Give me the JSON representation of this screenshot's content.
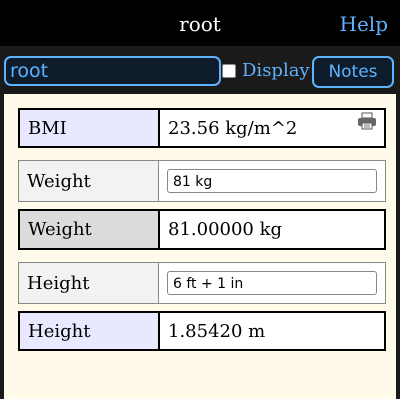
{
  "header": {
    "title": "root",
    "help_label": "Help"
  },
  "toolbar": {
    "search_value": "root",
    "display_label": "Display",
    "notes_label": "Notes"
  },
  "rows": [
    {
      "label": "BMI",
      "value": "23.56 kg/m^2"
    },
    {
      "label": "Weight",
      "input": "81 kg"
    },
    {
      "label": "Weight",
      "value": "81.00000 kg"
    },
    {
      "label": "Height",
      "input": "6 ft + 1 in"
    },
    {
      "label": "Height",
      "value": "1.85420 m"
    }
  ],
  "colors": {
    "accent": "#5eb3ff",
    "panel_bg": "#fffbe8",
    "bmi_label_bg": "#e8e8ff",
    "weight_out_label_bg": "#dcdcdc"
  }
}
